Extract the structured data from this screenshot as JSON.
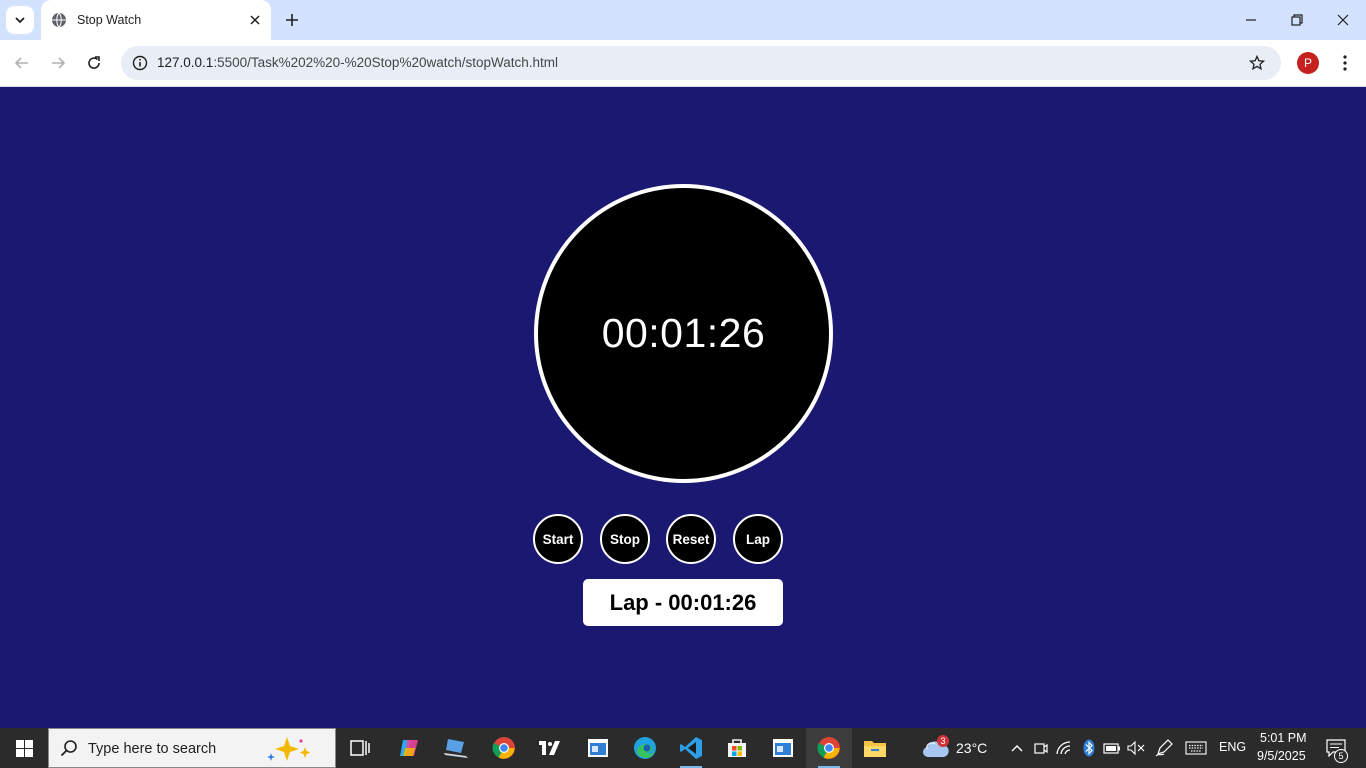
{
  "browser": {
    "tab_title": "Stop Watch",
    "url_host": "127.0.0.1",
    "url_path": ":5500/Task%202%20-%20Stop%20watch/stopWatch.html",
    "profile_initial": "P"
  },
  "stopwatch": {
    "time_display": "00:01:26",
    "buttons": {
      "start": "Start",
      "stop": "Stop",
      "reset": "Reset",
      "lap": "Lap"
    },
    "lap_entry": "Lap - 00:01:26"
  },
  "taskbar": {
    "search_placeholder": "Type here to search",
    "weather_temp": "23°C",
    "weather_badge": "3",
    "language": "ENG",
    "time": "5:01 PM",
    "date": "9/5/2025",
    "notification_count": "5"
  },
  "colors": {
    "page_background": "#1a1870",
    "clock_face": "#000000",
    "clock_border": "#ffffff",
    "tab_strip": "#d3e3fd"
  }
}
